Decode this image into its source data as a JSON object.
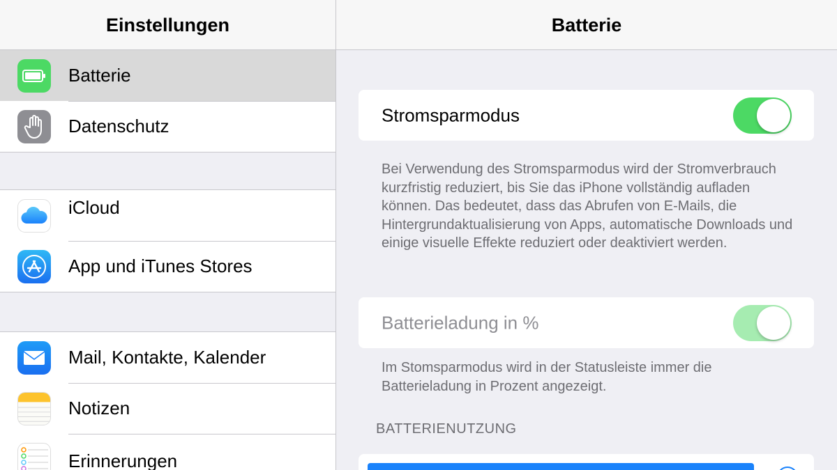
{
  "sidebar": {
    "title": "Einstellungen",
    "groups": [
      [
        {
          "label": "Batterie",
          "icon": "battery-icon",
          "selected": true
        },
        {
          "label": "Datenschutz",
          "icon": "hand-icon"
        }
      ],
      [
        {
          "label": "iCloud",
          "icon": "icloud-icon"
        },
        {
          "label": "App und iTunes Stores",
          "icon": "app-store-icon"
        }
      ],
      [
        {
          "label": "Mail, Kontakte, Kalender",
          "icon": "mail-icon"
        },
        {
          "label": "Notizen",
          "icon": "notes-icon"
        },
        {
          "label": "Erinnerungen",
          "icon": "reminders-icon"
        }
      ]
    ]
  },
  "detail": {
    "title": "Batterie",
    "low_power": {
      "label": "Stromsparmodus",
      "on": true,
      "footer": "Bei Verwendung des Stromsparmodus wird der Stromverbrauch kurzfristig reduziert, bis Sie das iPhone vollständig aufladen können. Das bedeutet, dass das Abrufen von E-Mails, die Hintergrundaktualisierung von Apps, automatische Downloads und einige visuelle Effekte reduziert oder deaktiviert werden."
    },
    "percentage": {
      "label": "Batterieladung in %",
      "on": true,
      "disabled": true,
      "footer": "Im Stomsparmodus wird in der Statusleiste immer die Batterieladung in Prozent angezeigt."
    },
    "usage_section": "BATTERIENUTZUNG"
  },
  "colors": {
    "accent_green": "#4cd964",
    "accent_blue": "#1a82fb"
  }
}
